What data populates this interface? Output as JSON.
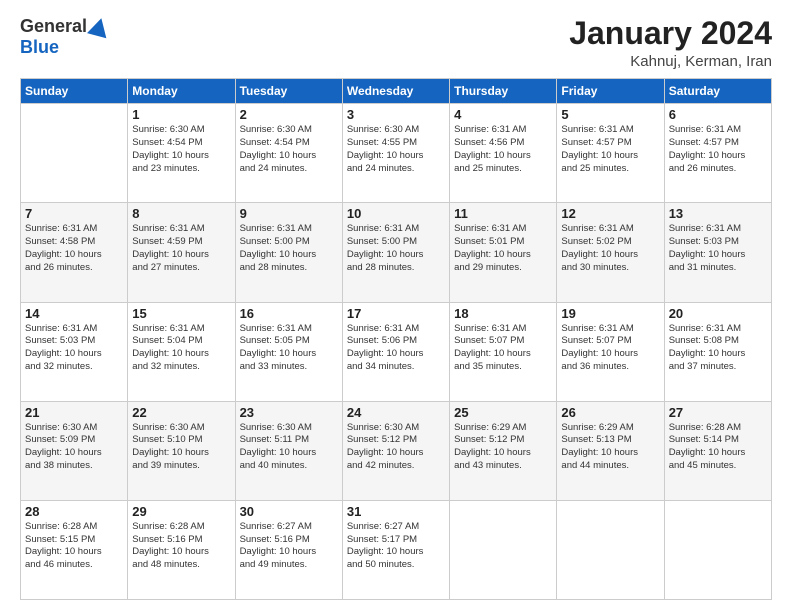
{
  "header": {
    "logo_general": "General",
    "logo_blue": "Blue",
    "month_title": "January 2024",
    "location": "Kahnuj, Kerman, Iran"
  },
  "weekdays": [
    "Sunday",
    "Monday",
    "Tuesday",
    "Wednesday",
    "Thursday",
    "Friday",
    "Saturday"
  ],
  "weeks": [
    [
      {
        "day": "",
        "detail": ""
      },
      {
        "day": "1",
        "detail": "Sunrise: 6:30 AM\nSunset: 4:54 PM\nDaylight: 10 hours\nand 23 minutes."
      },
      {
        "day": "2",
        "detail": "Sunrise: 6:30 AM\nSunset: 4:54 PM\nDaylight: 10 hours\nand 24 minutes."
      },
      {
        "day": "3",
        "detail": "Sunrise: 6:30 AM\nSunset: 4:55 PM\nDaylight: 10 hours\nand 24 minutes."
      },
      {
        "day": "4",
        "detail": "Sunrise: 6:31 AM\nSunset: 4:56 PM\nDaylight: 10 hours\nand 25 minutes."
      },
      {
        "day": "5",
        "detail": "Sunrise: 6:31 AM\nSunset: 4:57 PM\nDaylight: 10 hours\nand 25 minutes."
      },
      {
        "day": "6",
        "detail": "Sunrise: 6:31 AM\nSunset: 4:57 PM\nDaylight: 10 hours\nand 26 minutes."
      }
    ],
    [
      {
        "day": "7",
        "detail": "Sunrise: 6:31 AM\nSunset: 4:58 PM\nDaylight: 10 hours\nand 26 minutes."
      },
      {
        "day": "8",
        "detail": "Sunrise: 6:31 AM\nSunset: 4:59 PM\nDaylight: 10 hours\nand 27 minutes."
      },
      {
        "day": "9",
        "detail": "Sunrise: 6:31 AM\nSunset: 5:00 PM\nDaylight: 10 hours\nand 28 minutes."
      },
      {
        "day": "10",
        "detail": "Sunrise: 6:31 AM\nSunset: 5:00 PM\nDaylight: 10 hours\nand 28 minutes."
      },
      {
        "day": "11",
        "detail": "Sunrise: 6:31 AM\nSunset: 5:01 PM\nDaylight: 10 hours\nand 29 minutes."
      },
      {
        "day": "12",
        "detail": "Sunrise: 6:31 AM\nSunset: 5:02 PM\nDaylight: 10 hours\nand 30 minutes."
      },
      {
        "day": "13",
        "detail": "Sunrise: 6:31 AM\nSunset: 5:03 PM\nDaylight: 10 hours\nand 31 minutes."
      }
    ],
    [
      {
        "day": "14",
        "detail": "Sunrise: 6:31 AM\nSunset: 5:03 PM\nDaylight: 10 hours\nand 32 minutes."
      },
      {
        "day": "15",
        "detail": "Sunrise: 6:31 AM\nSunset: 5:04 PM\nDaylight: 10 hours\nand 32 minutes."
      },
      {
        "day": "16",
        "detail": "Sunrise: 6:31 AM\nSunset: 5:05 PM\nDaylight: 10 hours\nand 33 minutes."
      },
      {
        "day": "17",
        "detail": "Sunrise: 6:31 AM\nSunset: 5:06 PM\nDaylight: 10 hours\nand 34 minutes."
      },
      {
        "day": "18",
        "detail": "Sunrise: 6:31 AM\nSunset: 5:07 PM\nDaylight: 10 hours\nand 35 minutes."
      },
      {
        "day": "19",
        "detail": "Sunrise: 6:31 AM\nSunset: 5:07 PM\nDaylight: 10 hours\nand 36 minutes."
      },
      {
        "day": "20",
        "detail": "Sunrise: 6:31 AM\nSunset: 5:08 PM\nDaylight: 10 hours\nand 37 minutes."
      }
    ],
    [
      {
        "day": "21",
        "detail": "Sunrise: 6:30 AM\nSunset: 5:09 PM\nDaylight: 10 hours\nand 38 minutes."
      },
      {
        "day": "22",
        "detail": "Sunrise: 6:30 AM\nSunset: 5:10 PM\nDaylight: 10 hours\nand 39 minutes."
      },
      {
        "day": "23",
        "detail": "Sunrise: 6:30 AM\nSunset: 5:11 PM\nDaylight: 10 hours\nand 40 minutes."
      },
      {
        "day": "24",
        "detail": "Sunrise: 6:30 AM\nSunset: 5:12 PM\nDaylight: 10 hours\nand 42 minutes."
      },
      {
        "day": "25",
        "detail": "Sunrise: 6:29 AM\nSunset: 5:12 PM\nDaylight: 10 hours\nand 43 minutes."
      },
      {
        "day": "26",
        "detail": "Sunrise: 6:29 AM\nSunset: 5:13 PM\nDaylight: 10 hours\nand 44 minutes."
      },
      {
        "day": "27",
        "detail": "Sunrise: 6:28 AM\nSunset: 5:14 PM\nDaylight: 10 hours\nand 45 minutes."
      }
    ],
    [
      {
        "day": "28",
        "detail": "Sunrise: 6:28 AM\nSunset: 5:15 PM\nDaylight: 10 hours\nand 46 minutes."
      },
      {
        "day": "29",
        "detail": "Sunrise: 6:28 AM\nSunset: 5:16 PM\nDaylight: 10 hours\nand 48 minutes."
      },
      {
        "day": "30",
        "detail": "Sunrise: 6:27 AM\nSunset: 5:16 PM\nDaylight: 10 hours\nand 49 minutes."
      },
      {
        "day": "31",
        "detail": "Sunrise: 6:27 AM\nSunset: 5:17 PM\nDaylight: 10 hours\nand 50 minutes."
      },
      {
        "day": "",
        "detail": ""
      },
      {
        "day": "",
        "detail": ""
      },
      {
        "day": "",
        "detail": ""
      }
    ]
  ]
}
